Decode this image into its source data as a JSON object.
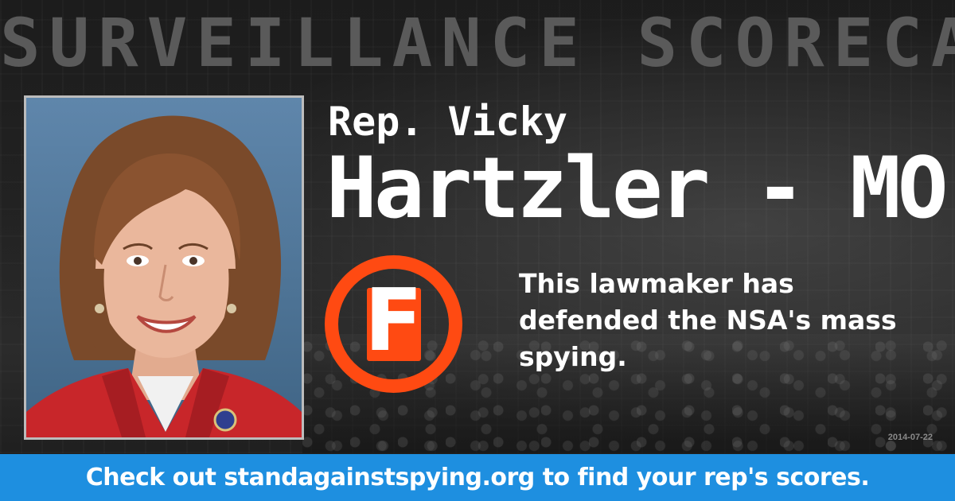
{
  "headline": "SURVEILLANCE SCORECARD",
  "representative": {
    "prefix": "Rep. Vicky",
    "name_state": "Hartzler - MO",
    "photo": "portrait-photo"
  },
  "grade": {
    "letter": "F",
    "ring_color": "#ff4a12"
  },
  "verdict": "This lawmaker has defended the NSA's mass spying.",
  "date": "2014-07-22",
  "footer": {
    "prefix": "Check out ",
    "link_text": "standagainstspying.org",
    "suffix": " to find your rep's scores.",
    "background_color": "#1e8fe0"
  }
}
